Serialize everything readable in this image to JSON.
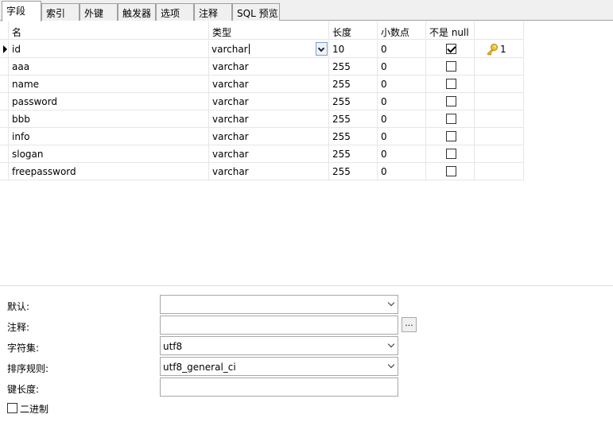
{
  "tabs": [
    "字段",
    "索引",
    "外键",
    "触发器",
    "选项",
    "注释",
    "SQL 预览"
  ],
  "columns": {
    "name": "名",
    "type": "类型",
    "length": "长度",
    "decimals": "小数点",
    "not_null": "不是 null"
  },
  "fields": [
    {
      "name": "id",
      "type": "varchar",
      "length": "10",
      "decimals": "0",
      "not_null": true,
      "key": "1"
    },
    {
      "name": "aaa",
      "type": "varchar",
      "length": "255",
      "decimals": "0",
      "not_null": false,
      "key": ""
    },
    {
      "name": "name",
      "type": "varchar",
      "length": "255",
      "decimals": "0",
      "not_null": false,
      "key": ""
    },
    {
      "name": "password",
      "type": "varchar",
      "length": "255",
      "decimals": "0",
      "not_null": false,
      "key": ""
    },
    {
      "name": "bbb",
      "type": "varchar",
      "length": "255",
      "decimals": "0",
      "not_null": false,
      "key": ""
    },
    {
      "name": "info",
      "type": "varchar",
      "length": "255",
      "decimals": "0",
      "not_null": false,
      "key": ""
    },
    {
      "name": "slogan",
      "type": "varchar",
      "length": "255",
      "decimals": "0",
      "not_null": false,
      "key": ""
    },
    {
      "name": "freepassword",
      "type": "varchar",
      "length": "255",
      "decimals": "0",
      "not_null": false,
      "key": ""
    }
  ],
  "properties": {
    "default_label": "默认:",
    "default_value": "",
    "comment_label": "注释:",
    "comment_value": "",
    "comment_more": "...",
    "charset_label": "字符集:",
    "charset_value": "utf8",
    "collation_label": "排序规则:",
    "collation_value": "utf8_general_ci",
    "key_length_label": "键长度:",
    "key_length_value": "",
    "binary_label": "二进制",
    "binary_checked": false
  },
  "icons": {
    "row_indicator": "triangle-right-icon",
    "primary_key": "key-icon",
    "dropdown": "chevron-down-icon"
  }
}
